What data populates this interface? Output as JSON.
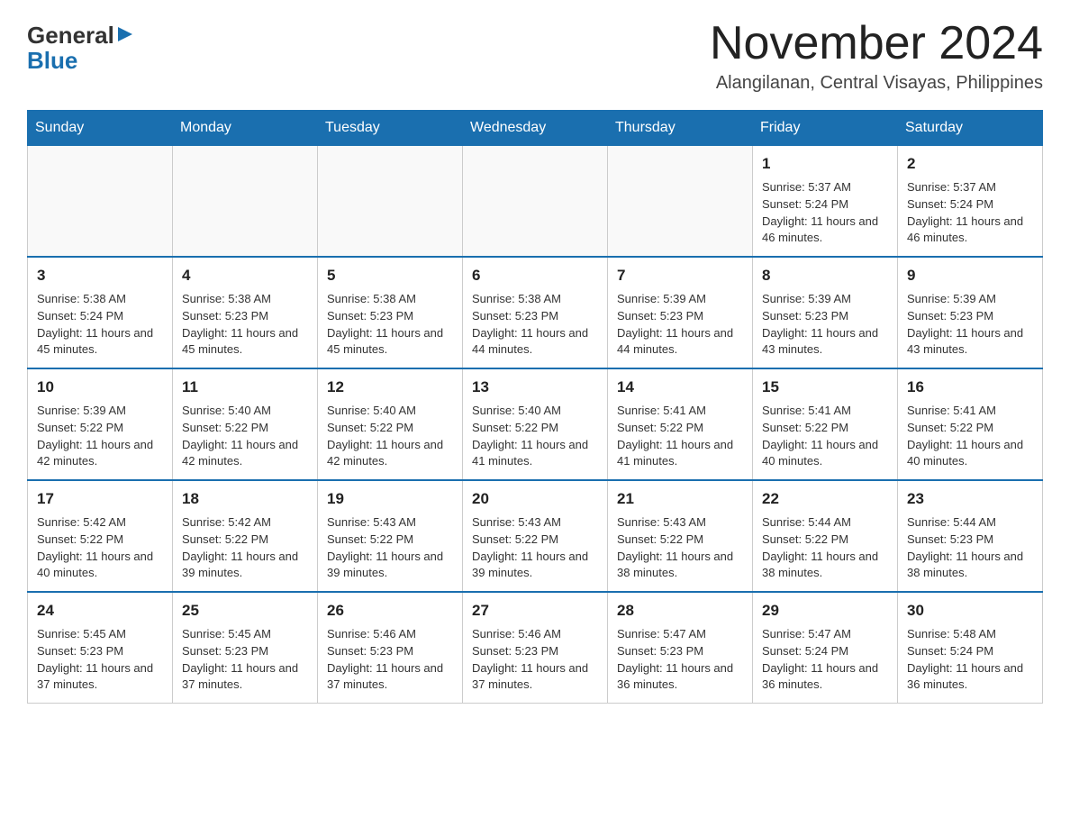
{
  "logo": {
    "general": "General",
    "blue": "Blue"
  },
  "title": "November 2024",
  "location": "Alangilanan, Central Visayas, Philippines",
  "days_of_week": [
    "Sunday",
    "Monday",
    "Tuesday",
    "Wednesday",
    "Thursday",
    "Friday",
    "Saturday"
  ],
  "weeks": [
    [
      {
        "day": "",
        "info": ""
      },
      {
        "day": "",
        "info": ""
      },
      {
        "day": "",
        "info": ""
      },
      {
        "day": "",
        "info": ""
      },
      {
        "day": "",
        "info": ""
      },
      {
        "day": "1",
        "info": "Sunrise: 5:37 AM\nSunset: 5:24 PM\nDaylight: 11 hours and 46 minutes."
      },
      {
        "day": "2",
        "info": "Sunrise: 5:37 AM\nSunset: 5:24 PM\nDaylight: 11 hours and 46 minutes."
      }
    ],
    [
      {
        "day": "3",
        "info": "Sunrise: 5:38 AM\nSunset: 5:24 PM\nDaylight: 11 hours and 45 minutes."
      },
      {
        "day": "4",
        "info": "Sunrise: 5:38 AM\nSunset: 5:23 PM\nDaylight: 11 hours and 45 minutes."
      },
      {
        "day": "5",
        "info": "Sunrise: 5:38 AM\nSunset: 5:23 PM\nDaylight: 11 hours and 45 minutes."
      },
      {
        "day": "6",
        "info": "Sunrise: 5:38 AM\nSunset: 5:23 PM\nDaylight: 11 hours and 44 minutes."
      },
      {
        "day": "7",
        "info": "Sunrise: 5:39 AM\nSunset: 5:23 PM\nDaylight: 11 hours and 44 minutes."
      },
      {
        "day": "8",
        "info": "Sunrise: 5:39 AM\nSunset: 5:23 PM\nDaylight: 11 hours and 43 minutes."
      },
      {
        "day": "9",
        "info": "Sunrise: 5:39 AM\nSunset: 5:23 PM\nDaylight: 11 hours and 43 minutes."
      }
    ],
    [
      {
        "day": "10",
        "info": "Sunrise: 5:39 AM\nSunset: 5:22 PM\nDaylight: 11 hours and 42 minutes."
      },
      {
        "day": "11",
        "info": "Sunrise: 5:40 AM\nSunset: 5:22 PM\nDaylight: 11 hours and 42 minutes."
      },
      {
        "day": "12",
        "info": "Sunrise: 5:40 AM\nSunset: 5:22 PM\nDaylight: 11 hours and 42 minutes."
      },
      {
        "day": "13",
        "info": "Sunrise: 5:40 AM\nSunset: 5:22 PM\nDaylight: 11 hours and 41 minutes."
      },
      {
        "day": "14",
        "info": "Sunrise: 5:41 AM\nSunset: 5:22 PM\nDaylight: 11 hours and 41 minutes."
      },
      {
        "day": "15",
        "info": "Sunrise: 5:41 AM\nSunset: 5:22 PM\nDaylight: 11 hours and 40 minutes."
      },
      {
        "day": "16",
        "info": "Sunrise: 5:41 AM\nSunset: 5:22 PM\nDaylight: 11 hours and 40 minutes."
      }
    ],
    [
      {
        "day": "17",
        "info": "Sunrise: 5:42 AM\nSunset: 5:22 PM\nDaylight: 11 hours and 40 minutes."
      },
      {
        "day": "18",
        "info": "Sunrise: 5:42 AM\nSunset: 5:22 PM\nDaylight: 11 hours and 39 minutes."
      },
      {
        "day": "19",
        "info": "Sunrise: 5:43 AM\nSunset: 5:22 PM\nDaylight: 11 hours and 39 minutes."
      },
      {
        "day": "20",
        "info": "Sunrise: 5:43 AM\nSunset: 5:22 PM\nDaylight: 11 hours and 39 minutes."
      },
      {
        "day": "21",
        "info": "Sunrise: 5:43 AM\nSunset: 5:22 PM\nDaylight: 11 hours and 38 minutes."
      },
      {
        "day": "22",
        "info": "Sunrise: 5:44 AM\nSunset: 5:22 PM\nDaylight: 11 hours and 38 minutes."
      },
      {
        "day": "23",
        "info": "Sunrise: 5:44 AM\nSunset: 5:23 PM\nDaylight: 11 hours and 38 minutes."
      }
    ],
    [
      {
        "day": "24",
        "info": "Sunrise: 5:45 AM\nSunset: 5:23 PM\nDaylight: 11 hours and 37 minutes."
      },
      {
        "day": "25",
        "info": "Sunrise: 5:45 AM\nSunset: 5:23 PM\nDaylight: 11 hours and 37 minutes."
      },
      {
        "day": "26",
        "info": "Sunrise: 5:46 AM\nSunset: 5:23 PM\nDaylight: 11 hours and 37 minutes."
      },
      {
        "day": "27",
        "info": "Sunrise: 5:46 AM\nSunset: 5:23 PM\nDaylight: 11 hours and 37 minutes."
      },
      {
        "day": "28",
        "info": "Sunrise: 5:47 AM\nSunset: 5:23 PM\nDaylight: 11 hours and 36 minutes."
      },
      {
        "day": "29",
        "info": "Sunrise: 5:47 AM\nSunset: 5:24 PM\nDaylight: 11 hours and 36 minutes."
      },
      {
        "day": "30",
        "info": "Sunrise: 5:48 AM\nSunset: 5:24 PM\nDaylight: 11 hours and 36 minutes."
      }
    ]
  ]
}
